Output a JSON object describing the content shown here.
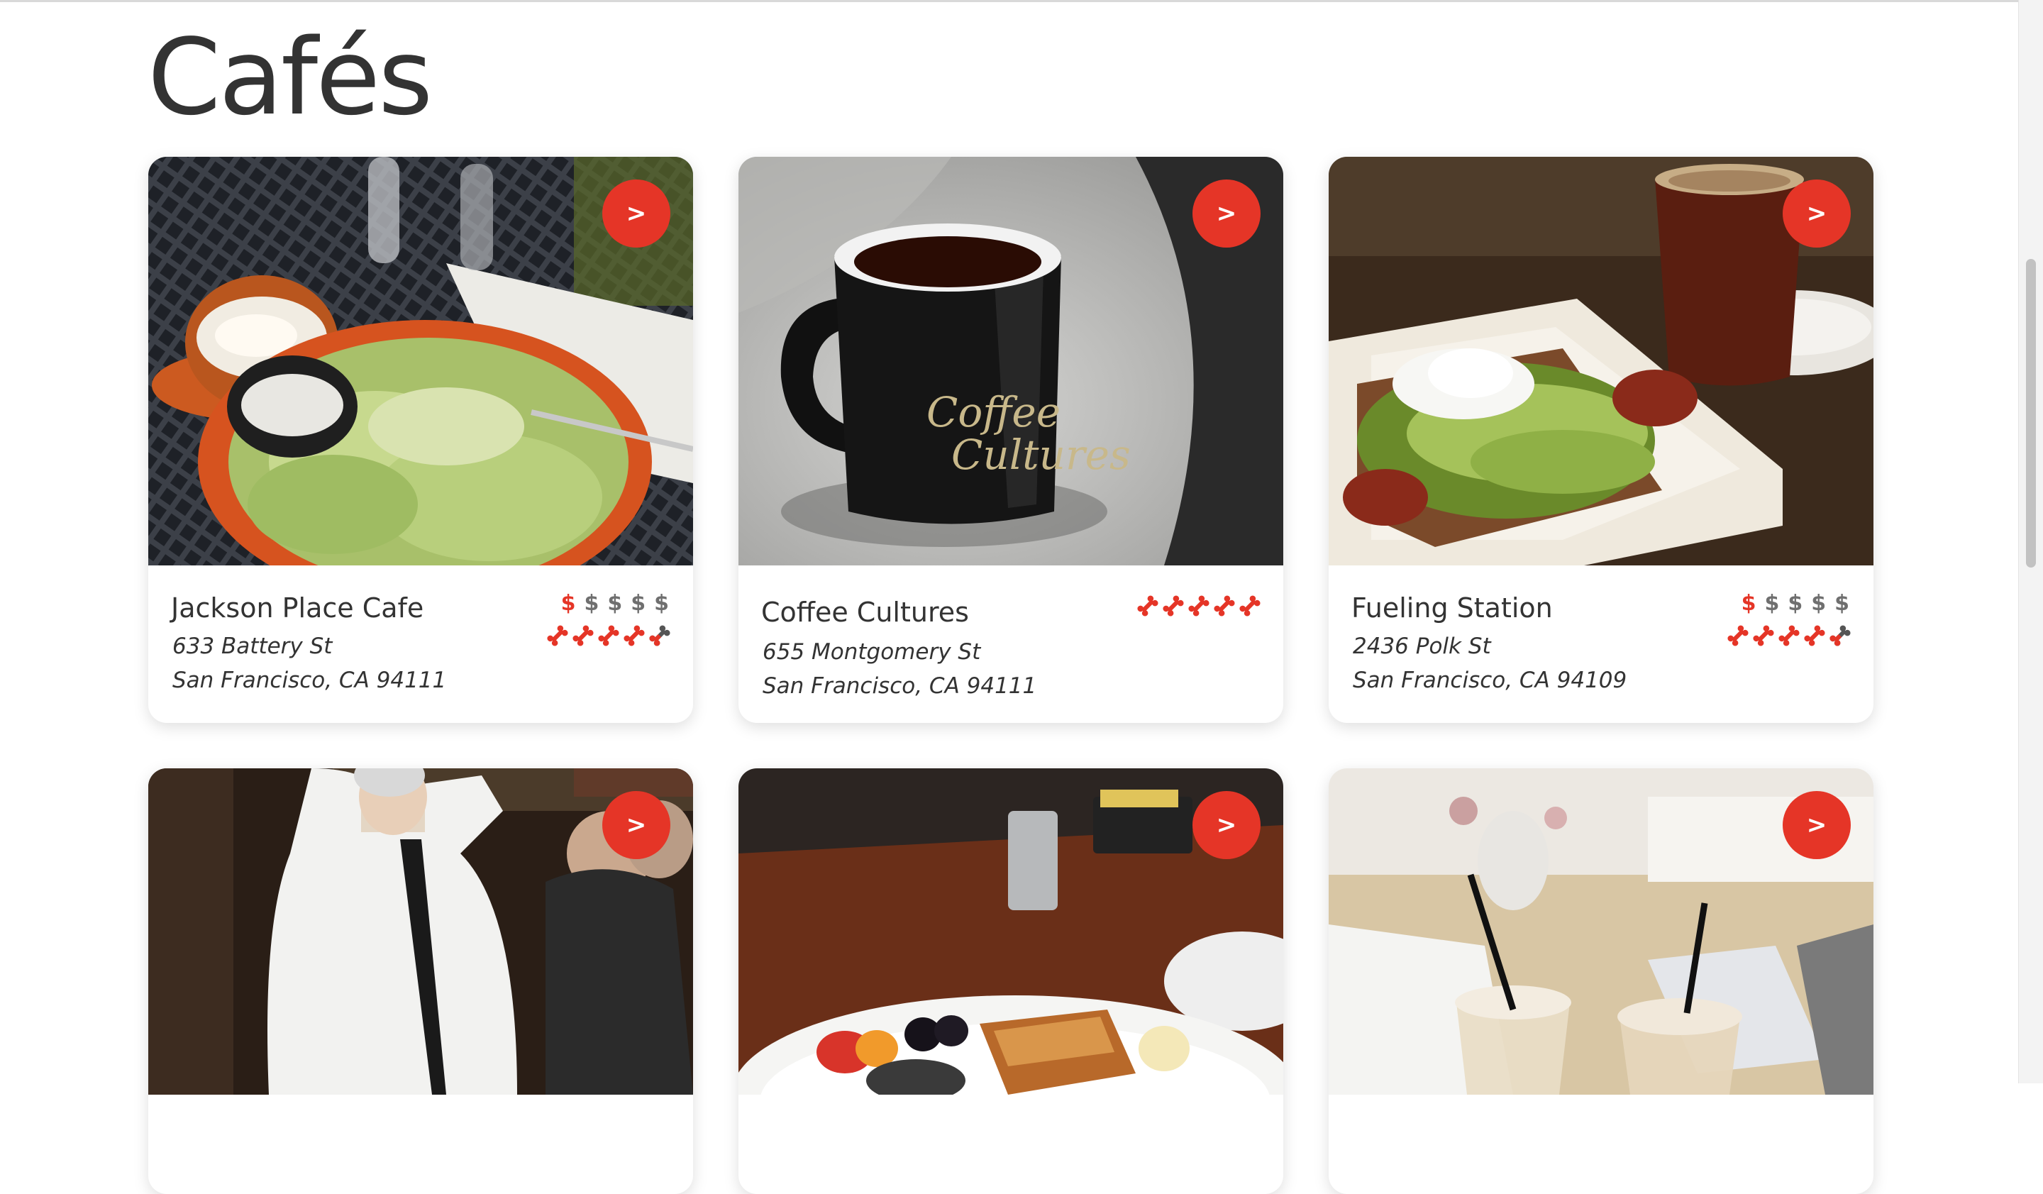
{
  "page": {
    "title": "Cafés"
  },
  "colors": {
    "accent": "#e53527",
    "price_inactive": "#6f6f6f",
    "text": "#333333"
  },
  "cards": [
    {
      "name": "Jackson Place Cafe",
      "address_line1": "633 Battery St",
      "address_line2": "San Francisco, CA 94111",
      "price_level": 1,
      "price_max": 5,
      "rating": 4.5,
      "rating_max": 5,
      "button_label": ">",
      "photo_subject": "caesar salad with latte"
    },
    {
      "name": "Coffee Cultures",
      "address_line1": "655 Montgomery St",
      "address_line2": "San Francisco, CA 94111",
      "price_level": 0,
      "price_max": 0,
      "rating": 5,
      "rating_max": 5,
      "button_label": ">",
      "photo_subject": "black coffee mug",
      "photo_mug_text": "Coffee Cultures"
    },
    {
      "name": "Fueling Station",
      "address_line1": "2436 Polk St",
      "address_line2": "San Francisco, CA 94109",
      "price_level": 1,
      "price_max": 5,
      "rating": 4.5,
      "rating_max": 5,
      "button_label": ">",
      "photo_subject": "avocado toast with coffee"
    },
    {
      "button_label": ">",
      "photo_subject": "waiter preparing table-side dish"
    },
    {
      "button_label": ">",
      "photo_subject": "french toast with berries"
    },
    {
      "button_label": ">",
      "photo_subject": "two iced drinks"
    }
  ]
}
